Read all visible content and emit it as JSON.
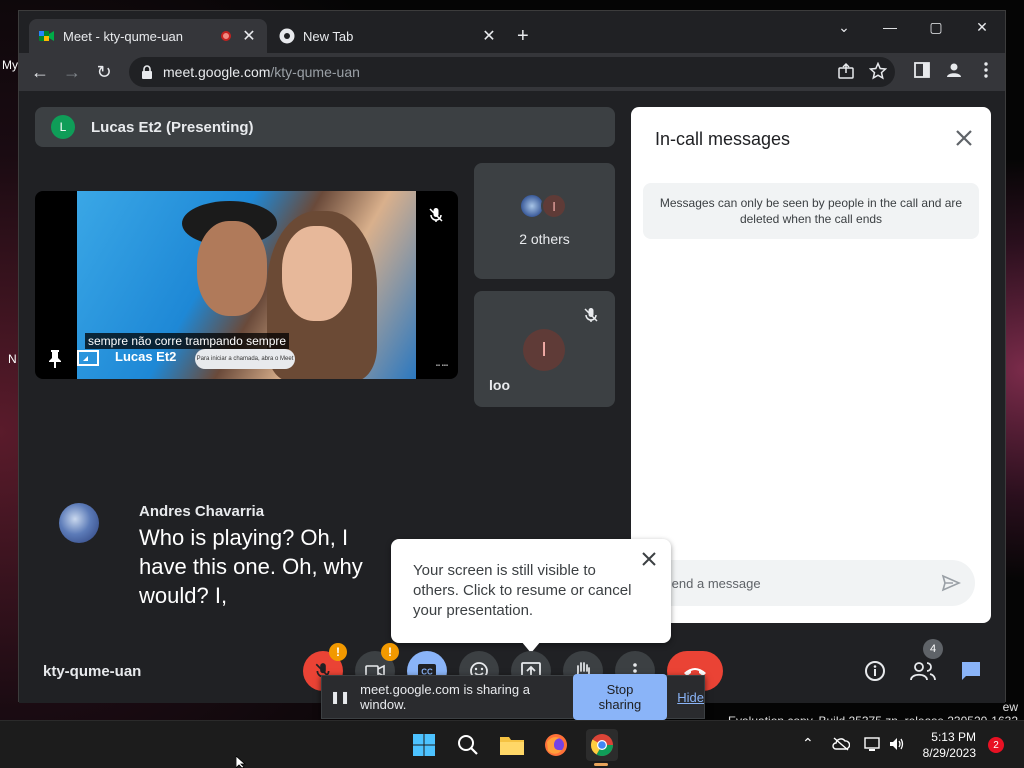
{
  "desktop": {
    "left_labels": [
      "My",
      "N"
    ],
    "eval_text": "Evaluation copy. Build 25375.zn_release.230520-1632",
    "eval_prefix": "ew"
  },
  "browser": {
    "tabs": [
      {
        "title": "Meet - kty-qume-uan",
        "recording": true
      },
      {
        "title": "New Tab"
      }
    ],
    "url_host": "meet.google.com",
    "url_path": "/kty-qume-uan"
  },
  "meet": {
    "presenter": {
      "initial": "L",
      "label": "Lucas Et2 (Presenting)"
    },
    "main_tile": {
      "name": "Lucas Et2",
      "caption": "sempre não corre trampando sempre",
      "pill_text": "Para iniciar a chamada, abra o Meet"
    },
    "others_tile": {
      "initial": "I",
      "label": "2 others"
    },
    "loo_tile": {
      "initial": "I",
      "name": "loo"
    },
    "speaker": {
      "name": "Andres Chavarria",
      "text": "Who is playing? Oh, I have this one. Oh, why would? I,"
    },
    "panel": {
      "title": "In-call messages",
      "note": "Messages can only be seen by people in the call and are deleted when the call ends",
      "input_placeholder": "Send a message"
    },
    "tooltip": {
      "text": "Your screen is still visible to others. Click to resume or cancel your presentation."
    },
    "meeting_code": "kty-qume-uan",
    "people_count": "4",
    "share_bar": {
      "text": "meet.google.com is sharing a window.",
      "stop_label": "Stop sharing",
      "hide_label": "Hide"
    }
  },
  "taskbar": {
    "time": "5:13 PM",
    "date": "8/29/2023",
    "notifications": "2"
  },
  "colors": {
    "meet_bg": "#202124",
    "accent_blue": "#8ab4f8",
    "hangup_red": "#ea4335",
    "warning": "#f29900"
  }
}
